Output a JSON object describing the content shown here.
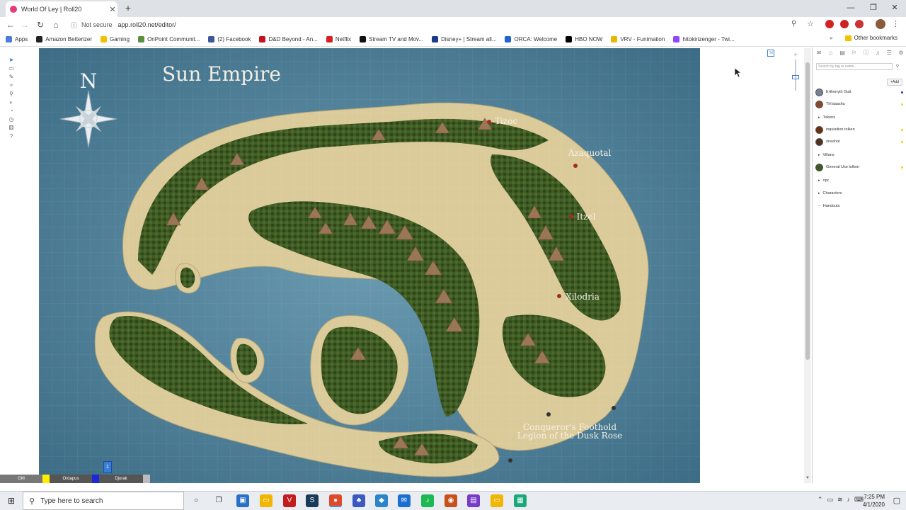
{
  "browser": {
    "tab_title": "World Of Ley | Roll20",
    "tab_close": "✕",
    "new_tab": "+",
    "url": "app.roll20.net/editor/",
    "security": "Not secure",
    "window_min": "—",
    "window_max": "❐",
    "window_close": "✕",
    "nav_back": "←",
    "nav_forward": "→",
    "nav_reload": "↻",
    "nav_home": "⌂",
    "info_icon": "ⓘ"
  },
  "bookmarks": [
    {
      "label": "Apps",
      "color": "#4a7fd6"
    },
    {
      "label": "Amazon Betterizer",
      "color": "#222222"
    },
    {
      "label": "Gaming",
      "color": "#f2c200"
    },
    {
      "label": "OnPoint Communit...",
      "color": "#5a8f3e"
    },
    {
      "label": "(2) Facebook",
      "color": "#3b5998"
    },
    {
      "label": "D&D Beyond - An...",
      "color": "#c0161c"
    },
    {
      "label": "Netflix",
      "color": "#d81f26"
    },
    {
      "label": "Stream TV and Mov...",
      "color": "#111111"
    },
    {
      "label": "Disney+ | Stream all...",
      "color": "#1a3a8a"
    },
    {
      "label": "ORCA: Welcome",
      "color": "#2266cc"
    },
    {
      "label": "HBO NOW",
      "color": "#000000"
    },
    {
      "label": "VRV - Funimation",
      "color": "#e8b800"
    },
    {
      "label": "hitokirizenger - Twi...",
      "color": "#9146ff"
    }
  ],
  "other_bookmarks": "Other bookmarks",
  "map": {
    "title": "Sun Empire",
    "compass": "N",
    "places": {
      "tizoc": "Tizoc",
      "azaquotal": "Azaquotal",
      "itzel": "Itzel",
      "xilodria": "Xilodria",
      "foothold1": "Conqueror's Foothold",
      "foothold2": "Legion of the Dusk Rose"
    }
  },
  "sidebar": {
    "search_placeholder": "Search by tag or name...",
    "add_label": "+Add",
    "entries": [
      {
        "label": "Erthenyth Gutt",
        "dot": "#2233cc",
        "avatar": "#7a7f9a"
      },
      {
        "label": "Thi'aaashu",
        "dot": "#dddd33",
        "avatar": "#8a4a2a"
      },
      {
        "label": "inquisition tolken",
        "dot": "#f0d000",
        "avatar": "#6a3010"
      },
      {
        "label": "oneshot",
        "dot": "#f0d000",
        "avatar": "#503020"
      },
      {
        "label": "General Use tolken",
        "dot": "#f0d000",
        "avatar": "#3e5a22"
      }
    ],
    "folders": {
      "tokens": "Tokens",
      "villans": "Villans",
      "npc": "npc",
      "characters": "Characters",
      "handouts": "Handouts"
    }
  },
  "players": [
    {
      "label": "GM",
      "color": "#777777"
    },
    {
      "label": "Ordapus",
      "color": "#555555"
    },
    {
      "label": "Djorak",
      "color": "#555555"
    }
  ],
  "player_colors": {
    "gm": "#ffee00",
    "ordapus": "#1a2ad8",
    "djorak": "#bbbbbb"
  },
  "page_marker": "1",
  "taskbar": {
    "search_placeholder": "Type here to search",
    "time": "7:25 PM",
    "date": "4/1/2020"
  },
  "colors": {
    "sea": "#3d6d86",
    "sea_light": "#6a9ab0",
    "sand": "#dccb9a",
    "forest": "#3f5b24",
    "forest_dark": "#2c4317",
    "mountain": "#9a7556"
  }
}
